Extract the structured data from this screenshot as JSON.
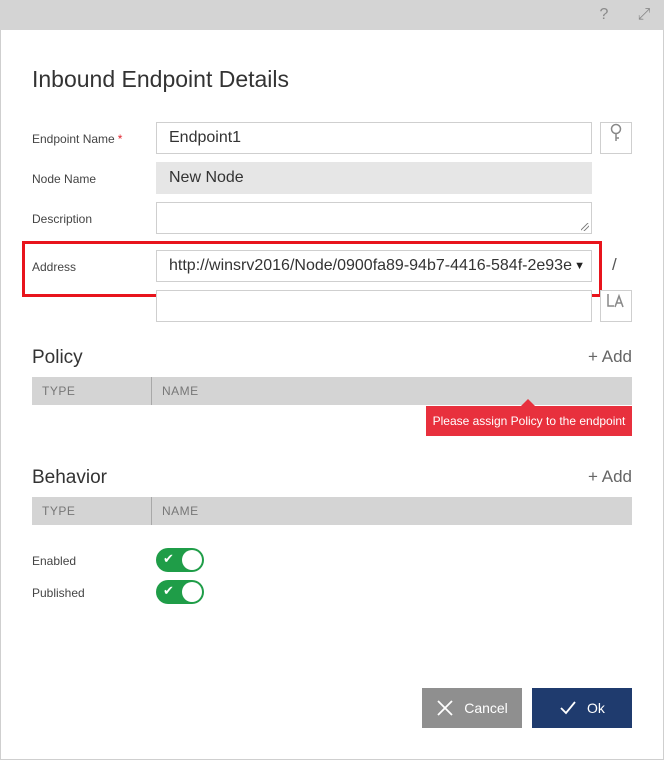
{
  "window": {
    "help_icon": "?",
    "expand_icon": "⤢"
  },
  "dialog": {
    "title": "Inbound Endpoint Details"
  },
  "form": {
    "endpoint_name_label": "Endpoint Name",
    "required_mark": "*",
    "endpoint_name_value": "Endpoint1",
    "node_name_label": "Node Name",
    "node_name_value": "New Node",
    "description_label": "Description",
    "description_value": "",
    "address_label": "Address",
    "address_value": "http://winsrv2016/Node/0900fa89-94b7-4416-584f-2e93e",
    "address_separator": "/",
    "address_suffix_value": ""
  },
  "policy": {
    "title": "Policy",
    "add_label": "+ Add",
    "col_type": "TYPE",
    "col_name": "NAME",
    "error_tooltip": "Please assign Policy to the endpoint"
  },
  "behavior": {
    "title": "Behavior",
    "add_label": "+ Add",
    "col_type": "TYPE",
    "col_name": "NAME"
  },
  "switches": {
    "enabled_label": "Enabled",
    "enabled_value": true,
    "published_label": "Published",
    "published_value": true
  },
  "buttons": {
    "cancel_label": "Cancel",
    "ok_label": "Ok"
  },
  "colors": {
    "accent_error": "#e8141c",
    "toggle_on": "#1f9d48",
    "ok_button": "#1f3b6e",
    "cancel_button": "#8f8f8f"
  }
}
